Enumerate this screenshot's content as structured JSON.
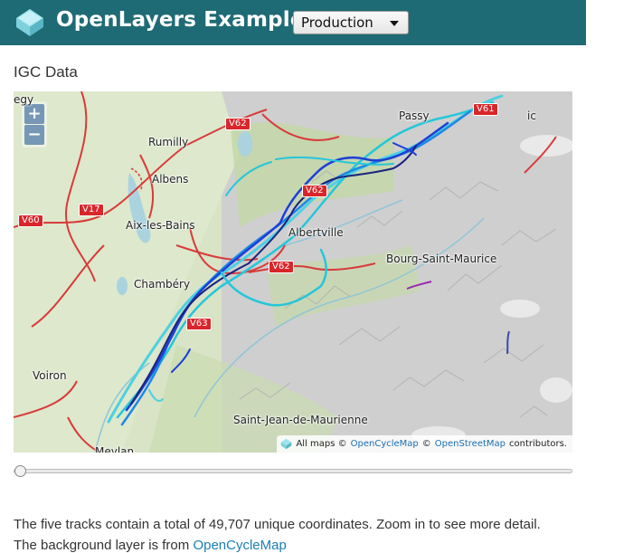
{
  "header": {
    "brand": "OpenLayers Examples",
    "version_select": "Production"
  },
  "example": {
    "title": "IGC Data"
  },
  "map": {
    "zoom_in": "+",
    "zoom_out": "−",
    "places": {
      "egy": "egy",
      "rumilly": "Rumilly",
      "albens": "Albens",
      "aix": "Aix-les-Bains",
      "chambery": "Chambéry",
      "voiron": "Voiron",
      "meylan": "Meylan",
      "passy": "Passy",
      "albertville": "Albertville",
      "bourg": "Bourg-Saint-Maurice",
      "saint_jean": "Saint-Jean-de-Maurienne",
      "ic": "ic"
    },
    "roads": {
      "v61": "V61",
      "v62_a": "V62",
      "v62_b": "V62",
      "v62_c": "V62",
      "v60": "V60",
      "v17": "V17",
      "v63": "V63"
    },
    "attribution": {
      "prefix": "All maps ©",
      "link1": "OpenCycleMap",
      "sep": "©",
      "link2": "OpenStreetMap",
      "suffix": "contributors."
    }
  },
  "time_slider": {
    "value": 0
  },
  "description": {
    "line1": "The five tracks contain a total of 49,707 unique coordinates. Zoom in to see more detail.",
    "line2_prefix": "The background layer is from",
    "line2_link": "OpenCycleMap"
  },
  "colors": {
    "header_bg": "#1f6b75",
    "track_colors": [
      "#1a237e",
      "#1e3fd6",
      "#1e88e5",
      "#26c6da",
      "#4dd0e1"
    ]
  }
}
